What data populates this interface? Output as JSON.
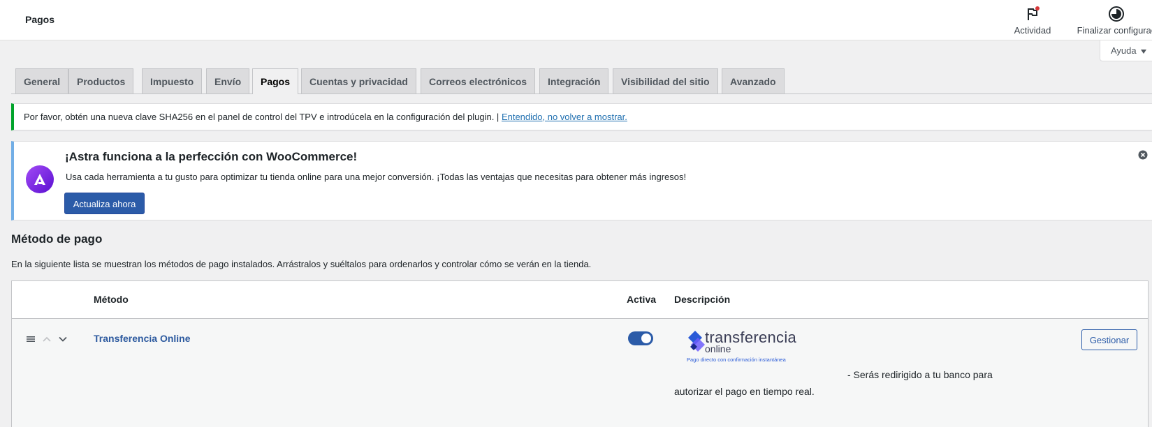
{
  "header": {
    "title": "Pagos",
    "activity_label": "Actividad",
    "finish_label": "Finalizar configurac",
    "help_label": "Ayuda"
  },
  "tabs": [
    {
      "label": "General",
      "active": false
    },
    {
      "label": "Productos",
      "active": false
    },
    {
      "label": "Impuesto",
      "active": false
    },
    {
      "label": "Envío",
      "active": false
    },
    {
      "label": "Pagos",
      "active": true
    },
    {
      "label": "Cuentas y privacidad",
      "active": false
    },
    {
      "label": "Correos electrónicos",
      "active": false
    },
    {
      "label": "Integración",
      "active": false
    },
    {
      "label": "Visibilidad del sitio",
      "active": false
    },
    {
      "label": "Avanzado",
      "active": false
    }
  ],
  "notice": {
    "text": "Por favor, obtén una nueva clave SHA256 en el panel de control del TPV e introdúcela en la configuración del plugin. |",
    "link": "Entendido, no volver a mostrar."
  },
  "astra_banner": {
    "title": "¡Astra funciona a la perfección con WooCommerce!",
    "description": "Usa cada herramienta a tu gusto para optimizar tu tienda online para una mejor conversión. ¡Todas las ventajas que necesitas para obtener más ingresos!",
    "button": "Actualiza ahora"
  },
  "payments": {
    "title": "Método de pago",
    "description": "En la siguiente lista se muestran los métodos de pago instalados. Arrástralos y suéltalos para ordenarlos y controlar cómo se verán en la tienda.",
    "columns": {
      "method": "Método",
      "active": "Activa",
      "description": "Descripción"
    },
    "rows": [
      {
        "name": "Transferencia Online",
        "enabled": true,
        "logo_text_1": "transferencia",
        "logo_text_2": "online",
        "logo_tagline": "Pago directo con confirmación instantánea",
        "description": "- Serás redirigido a tu banco para autorizar el pago en tiempo real.",
        "manage_label": "Gestionar"
      }
    ]
  },
  "colors": {
    "accent": "#2b5ba8",
    "notice_success": "#00a32a",
    "notice_info": "#72aee6"
  }
}
